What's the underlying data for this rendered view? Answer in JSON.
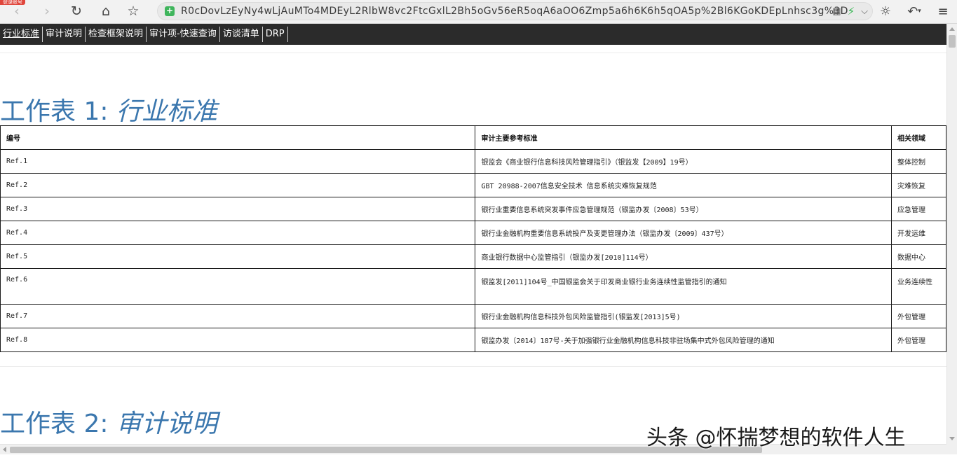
{
  "browser": {
    "badge": "登录账号",
    "url": "R0cDovLzEyNy4wLjAuMTo4MDEyL2RlbW8vc2FtcGxlL2Bh5oGv56eR5oqA6aOO6Zmp5a6h6K6h5qOA5p%2Bl6KGoKDEpLnhsc3g%3D"
  },
  "tabs": [
    "行业标准",
    "审计说明",
    "检查框架说明",
    "审计项-快速查询",
    "访谈清单",
    "DRP"
  ],
  "sheet1": {
    "title_prefix": "工作表 1: ",
    "title_name": "行业标准",
    "headers": [
      "编号",
      "审计主要参考标准",
      "相关领域"
    ],
    "rows": [
      {
        "id": "Ref.1",
        "standard": "银监会《商业银行信息科技风险管理指引》（银监发【2009】19号）",
        "domain": "整体控制",
        "color": "black"
      },
      {
        "id": "Ref.2",
        "standard": "GBT 20988-2007信息安全技术 信息系统灾难恢复规范",
        "domain": "灾难恢复",
        "color": "blue"
      },
      {
        "id": "Ref.3",
        "standard": "银行业重要信息系统突发事件应急管理规范（银监办发〔2008〕53号）",
        "domain": "应急管理",
        "color": "blue"
      },
      {
        "id": "Ref.4",
        "standard": "银行业金融机构重要信息系统投产及变更管理办法（银监办发〔2009〕437号）",
        "domain": "开发运维",
        "color": "black"
      },
      {
        "id": "Ref.5",
        "standard": "商业银行数据中心监管指引（银监办发[2010]114号）",
        "domain": "数据中心",
        "color": "red"
      },
      {
        "id": "Ref.6",
        "standard": "银监发[2011]104号_中国银监会关于印发商业银行业务连续性监管指引的通知",
        "domain": "业务连续性",
        "color": "blue"
      },
      {
        "id": "Ref.7",
        "standard": "银行业金融机构信息科技外包风险监管指引(银监发[2013]5号)",
        "domain": "外包管理",
        "color": "red"
      },
      {
        "id": "Ref.8",
        "standard": "银监办发〔2014〕187号-关于加强银行业金融机构信息科技非驻场集中式外包风险管理的通知",
        "domain": "外包管理",
        "color": "red"
      }
    ]
  },
  "sheet2": {
    "title_prefix": "工作表 2: ",
    "title_name": "审计说明"
  },
  "watermark": "头条 @怀揣梦想的软件人生",
  "colors": {
    "title_blue": "#3b77ae",
    "link_blue": "#3b77ae",
    "alert_red": "#d92b2b",
    "tab_bar": "#2b2b2b"
  }
}
